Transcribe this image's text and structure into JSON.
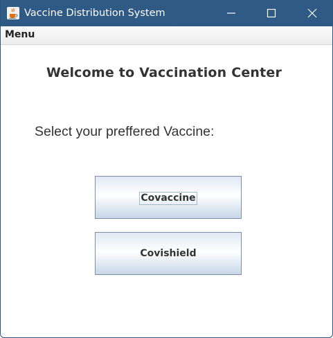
{
  "window": {
    "title": "Vaccine Distribution System",
    "title_bar_color": "#2e5a85",
    "icon": "java-cup-icon"
  },
  "menubar": {
    "items": [
      {
        "label": "Menu"
      }
    ]
  },
  "main": {
    "heading": "Welcome to Vaccination Center",
    "prompt": "Select your preffered Vaccine:",
    "buttons": [
      {
        "label": "Covaccine",
        "focused": true
      },
      {
        "label": "Covishield",
        "focused": false
      }
    ]
  }
}
